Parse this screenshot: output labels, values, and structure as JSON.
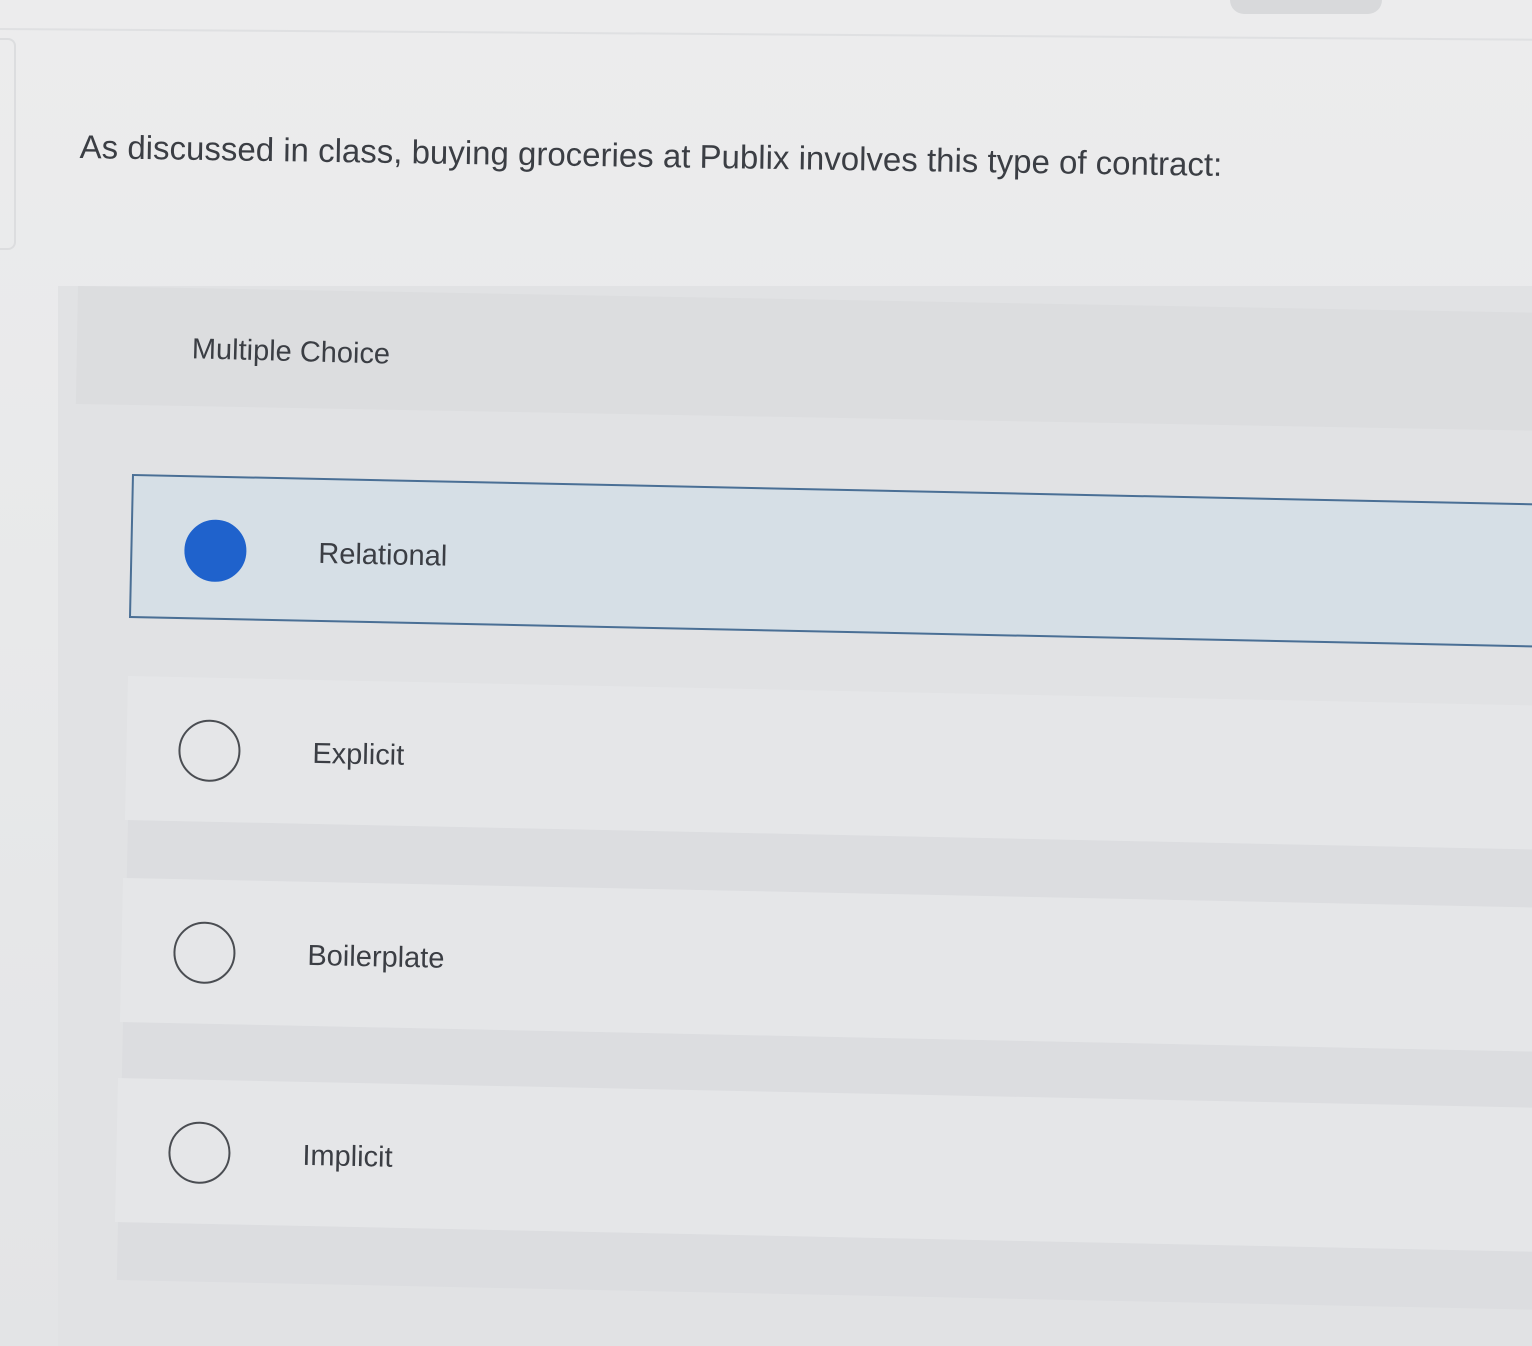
{
  "question": {
    "text": "As discussed in class, buying groceries at Publix involves this type of contract:"
  },
  "question_type": "Multiple Choice",
  "options": [
    {
      "label": "Relational",
      "selected": true
    },
    {
      "label": "Explicit",
      "selected": false
    },
    {
      "label": "Boilerplate",
      "selected": false
    },
    {
      "label": "Implicit",
      "selected": false
    }
  ],
  "colors": {
    "selected_fill": "#1f62cc",
    "selected_background": "#d6dfe6",
    "selected_border": "#4a6f95"
  }
}
